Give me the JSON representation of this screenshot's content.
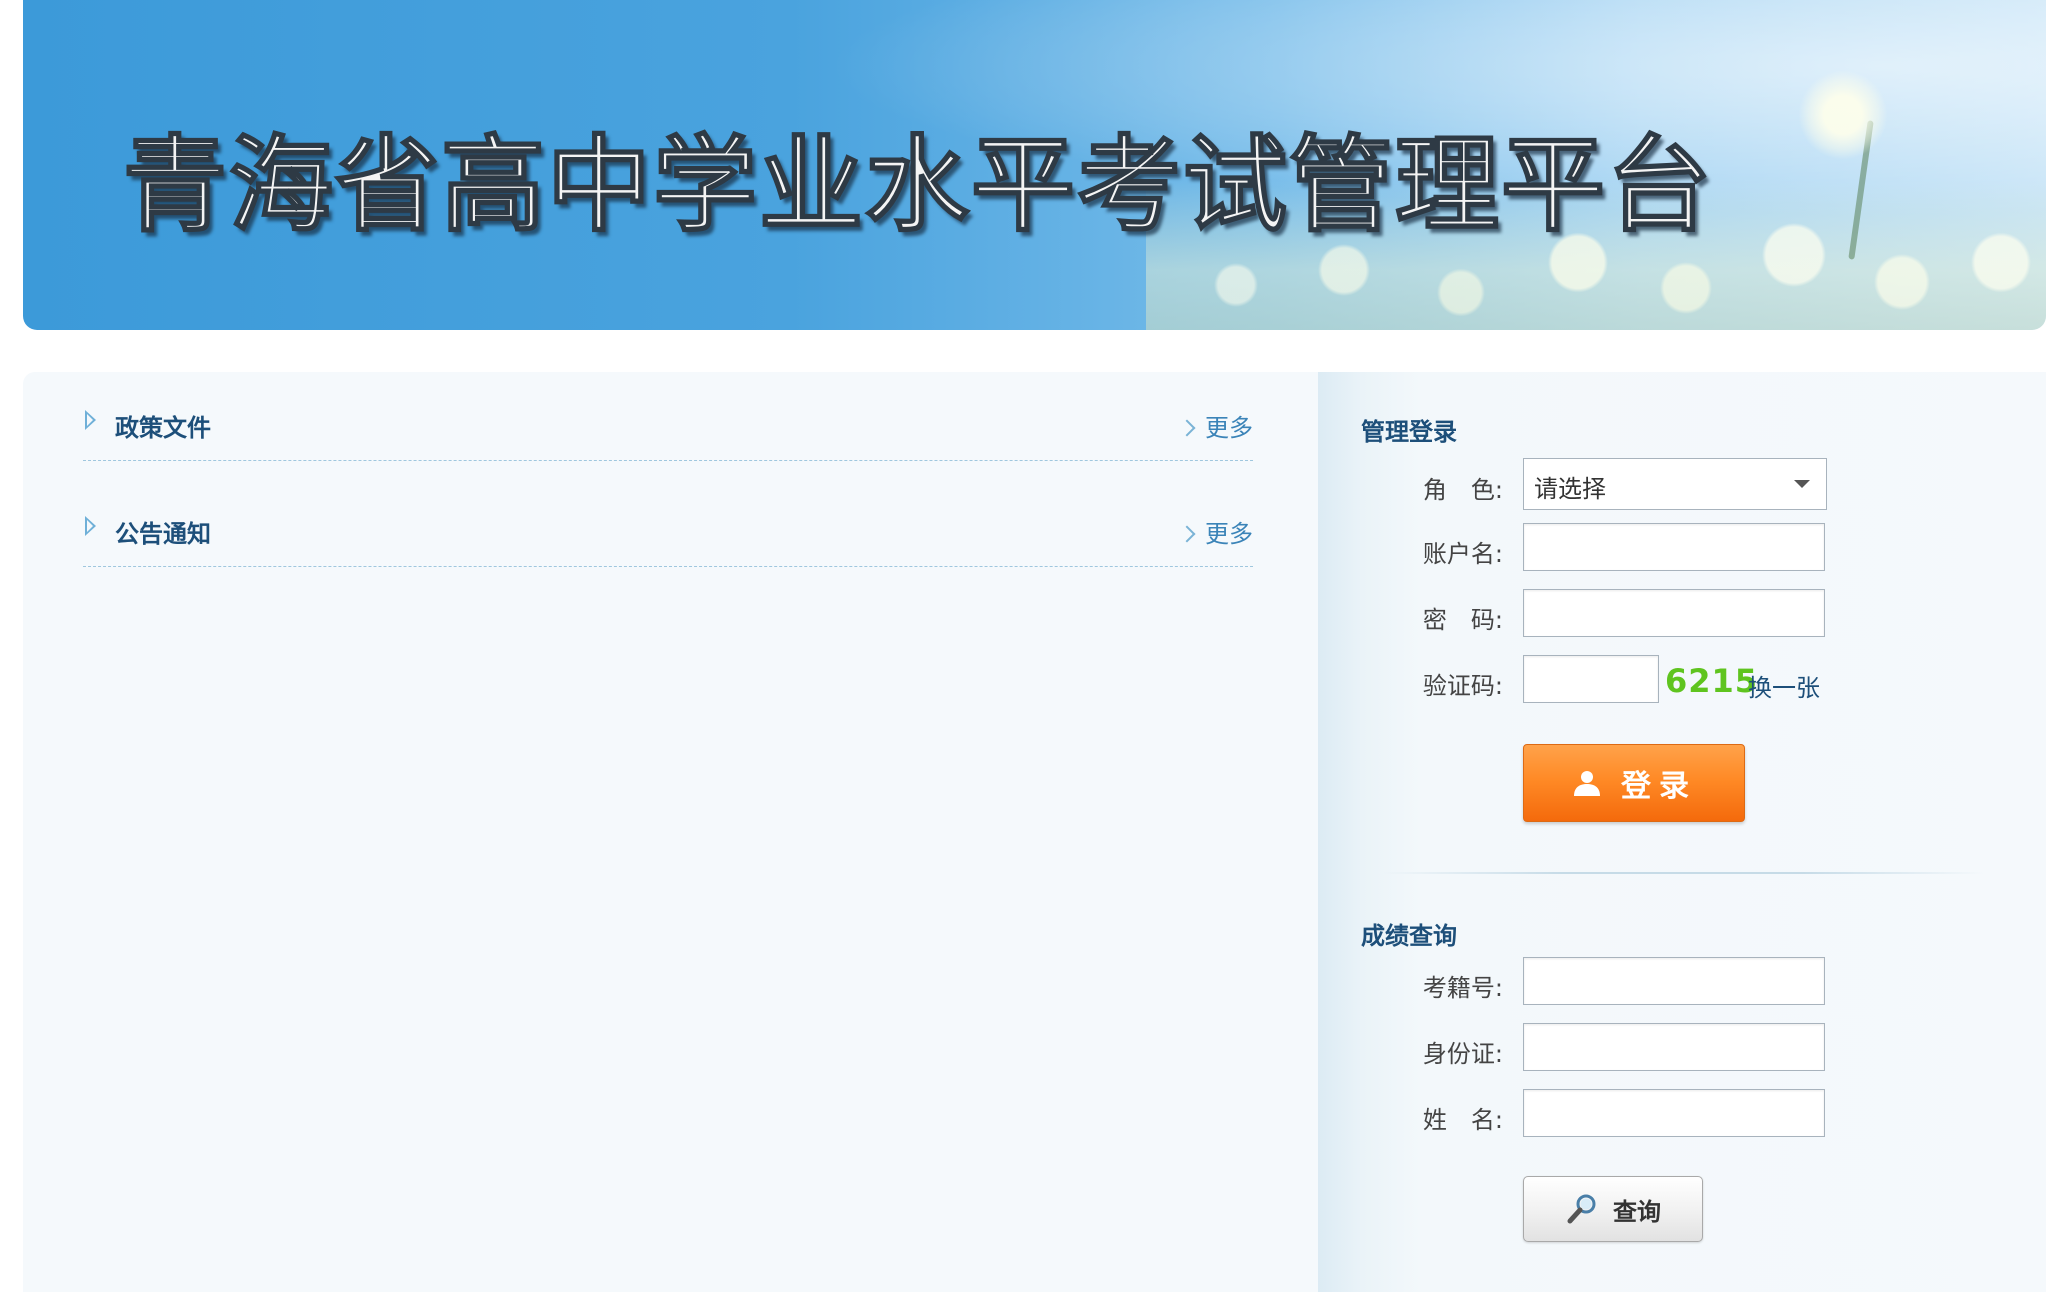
{
  "banner": {
    "title": "青海省高中学业水平考试管理平台"
  },
  "news": {
    "sections": [
      {
        "heading": "政策文件",
        "more": "更多"
      },
      {
        "heading": "公告通知",
        "more": "更多"
      }
    ]
  },
  "login": {
    "title": "管理登录",
    "role_label": "角　色:",
    "role_value": "请选择",
    "account_label": "账户名:",
    "account_value": "",
    "password_label": "密　码:",
    "password_value": "",
    "captcha_label": "验证码:",
    "captcha_value": "",
    "captcha_code": "6215",
    "captcha_refresh": "换一张",
    "submit_label": "登录"
  },
  "score_query": {
    "title": "成绩查询",
    "exam_id_label": "考籍号:",
    "exam_id_value": "",
    "id_card_label": "身份证:",
    "id_card_value": "",
    "name_label": "姓　名:",
    "name_value": "",
    "submit_label": "查询"
  },
  "colors": {
    "banner_blue": "#3c9ad9",
    "heading_blue": "#1d4f7a",
    "link_blue": "#3b84b8",
    "login_orange": "#ff8a26",
    "captcha_green": "#5fc41f",
    "panel_bg": "#f5f9fc"
  }
}
